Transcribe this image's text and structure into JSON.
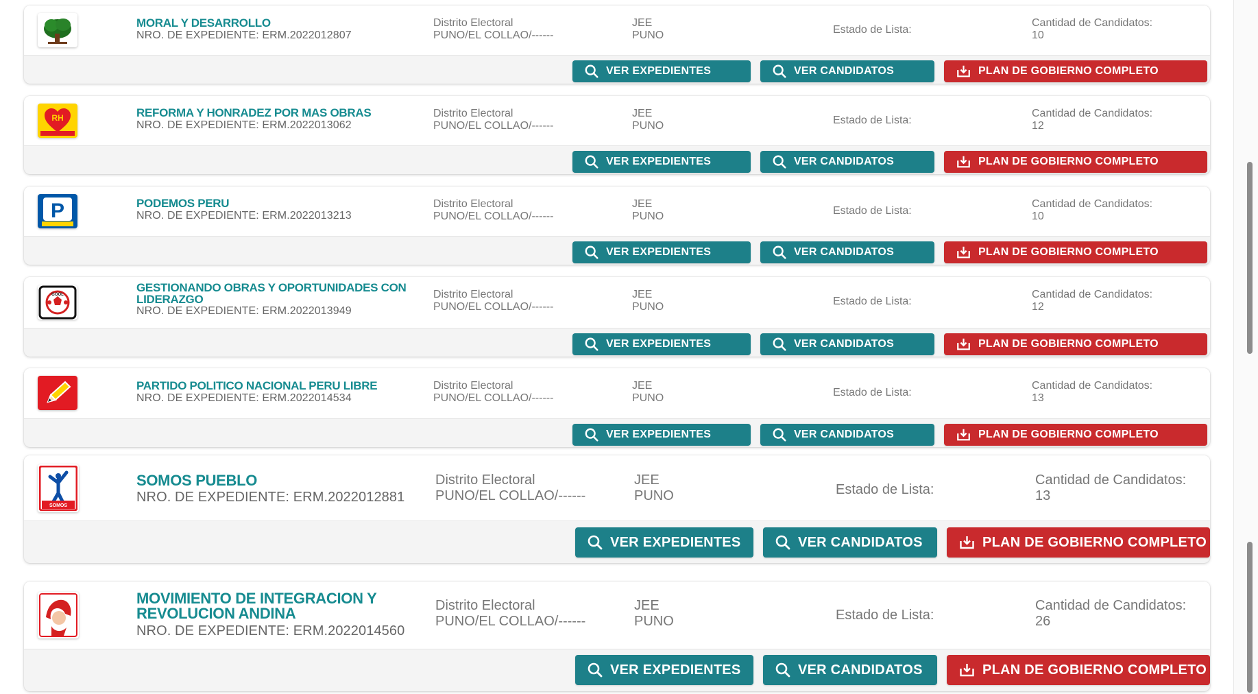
{
  "labels": {
    "distrito_title": "Distrito Electoral",
    "distrito_value": "PUNO/EL COLLAO/------",
    "jee_title": "JEE",
    "jee_value": "PUNO",
    "estado_label": "Estado de Lista:",
    "candidatos_label": "Cantidad de Candidatos:",
    "ver_expedientes": "VER EXPEDIENTES",
    "ver_candidatos": "VER CANDIDATOS",
    "plan_gobierno": "PLAN DE GOBIERNO COMPLETO"
  },
  "colors": {
    "party_name": "#168b90",
    "teal_button": "#1d8089",
    "red_button": "#c92a2d",
    "muted_text": "#777777"
  },
  "parties": [
    {
      "name": "MORAL Y DESARROLLO",
      "expediente": "NRO. DE EXPEDIENTE: ERM.2022012807",
      "distrito_title": "Distrito Electoral",
      "distrito": "PUNO/EL COLLAO/------",
      "jee_title": "JEE",
      "jee": "PUNO",
      "estado": "Estado de Lista:",
      "candidatos_label": "Cantidad de Candidatos:",
      "candidatos": "10",
      "logo_icon": "tree-icon"
    },
    {
      "name": "REFORMA Y HONRADEZ POR MAS OBRAS",
      "expediente": "NRO. DE EXPEDIENTE: ERM.2022013062",
      "distrito_title": "Distrito Electoral",
      "distrito": "PUNO/EL COLLAO/------",
      "jee_title": "JEE",
      "jee": "PUNO",
      "estado": "Estado de Lista:",
      "candidatos_label": "Cantidad de Candidatos:",
      "candidatos": "12",
      "logo_icon": "heart-obras-icon"
    },
    {
      "name": "PODEMOS PERU",
      "expediente": "NRO. DE EXPEDIENTE: ERM.2022013213",
      "distrito_title": "Distrito Electoral",
      "distrito": "PUNO/EL COLLAO/------",
      "jee_title": "JEE",
      "jee": "PUNO",
      "estado": "Estado de Lista:",
      "candidatos_label": "Cantidad de Candidatos:",
      "candidatos": "10",
      "logo_icon": "podemos-logo-icon"
    },
    {
      "name": "GESTIONANDO OBRAS Y OPORTUNIDADES CON LIDERAZGO",
      "expediente": "NRO. DE EXPEDIENTE: ERM.2022013949",
      "distrito_title": "Distrito Electoral",
      "distrito": "PUNO/EL COLLAO/------",
      "jee_title": "JEE",
      "jee": "PUNO",
      "estado": "Estado de Lista:",
      "candidatos_label": "Cantidad de Candidatos:",
      "candidatos": "12",
      "logo_icon": "soccer-ball-icon"
    },
    {
      "name": "PARTIDO POLITICO NACIONAL PERU LIBRE",
      "expediente": "NRO. DE EXPEDIENTE: ERM.2022014534",
      "distrito_title": "Distrito Electoral",
      "distrito": "PUNO/EL COLLAO/------",
      "jee_title": "JEE",
      "jee": "PUNO",
      "estado": "Estado de Lista:",
      "candidatos_label": "Cantidad de Candidatos:",
      "candidatos": "13",
      "logo_icon": "pencil-icon"
    },
    {
      "name": "SOMOS PUEBLO",
      "expediente": "NRO. DE EXPEDIENTE: ERM.2022012881",
      "distrito_title": "Distrito Electoral",
      "distrito": "PUNO/EL COLLAO/------",
      "jee_title": "JEE",
      "jee": "PUNO",
      "estado": "Estado de Lista:",
      "candidatos_label": "Cantidad de Candidatos:",
      "candidatos": "13",
      "logo_icon": "somos-pueblo-icon"
    },
    {
      "name": "MOVIMIENTO DE INTEGRACION Y REVOLUCION ANDINA",
      "expediente": "NRO. DE EXPEDIENTE: ERM.2022014560",
      "distrito_title": "Distrito Electoral",
      "distrito": "PUNO/EL COLLAO/------",
      "jee_title": "JEE",
      "jee": "PUNO",
      "estado": "Estado de Lista:",
      "candidatos_label": "Cantidad de Candidatos:",
      "candidatos": "26",
      "logo_icon": "andean-figure-icon"
    }
  ]
}
